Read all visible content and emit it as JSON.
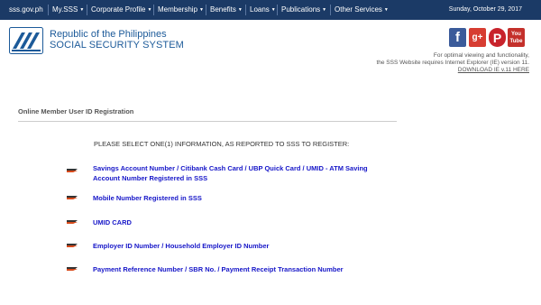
{
  "nav": {
    "items": [
      {
        "label": "sss.gov.ph",
        "caret": false
      },
      {
        "label": "My.SSS",
        "caret": true
      },
      {
        "label": "Corporate Profile",
        "caret": true
      },
      {
        "label": "Membership",
        "caret": true
      },
      {
        "label": "Benefits",
        "caret": true
      },
      {
        "label": "Loans",
        "caret": true
      },
      {
        "label": "Publications",
        "caret": true
      },
      {
        "label": "Other Services",
        "caret": true
      }
    ],
    "date": "Sunday, October 29, 2017"
  },
  "header": {
    "org_line1": "Republic of the Philippines",
    "org_line2": "SOCIAL SECURITY SYSTEM"
  },
  "social": {
    "facebook": "f",
    "googleplus": "g+",
    "pinterest": "P",
    "youtube_line1": "You",
    "youtube_line2": "Tube"
  },
  "ie_note": {
    "line1": "For optimal viewing and functionality,",
    "line2": "the SSS Website requires Internet Explorer (IE) version 11.",
    "link": "DOWNLOAD IE v.11 HERE"
  },
  "main": {
    "title": "Online Member User ID Registration",
    "instruction": "PLEASE SELECT ONE(1) INFORMATION, AS REPORTED TO SSS TO REGISTER:",
    "options": [
      "Savings Account Number / Citibank Cash Card / UBP Quick Card / UMID - ATM Saving Account Number Registered in SSS",
      "Mobile Number Registered in SSS",
      "UMID CARD",
      "Employer ID Number / Household Employer ID Number",
      "Payment Reference Number / SBR No. / Payment Receipt Transaction Number"
    ]
  },
  "colors": {
    "nav_bg": "#1b3a66",
    "brand_blue": "#1c5a99",
    "option_link": "#1616c8"
  }
}
